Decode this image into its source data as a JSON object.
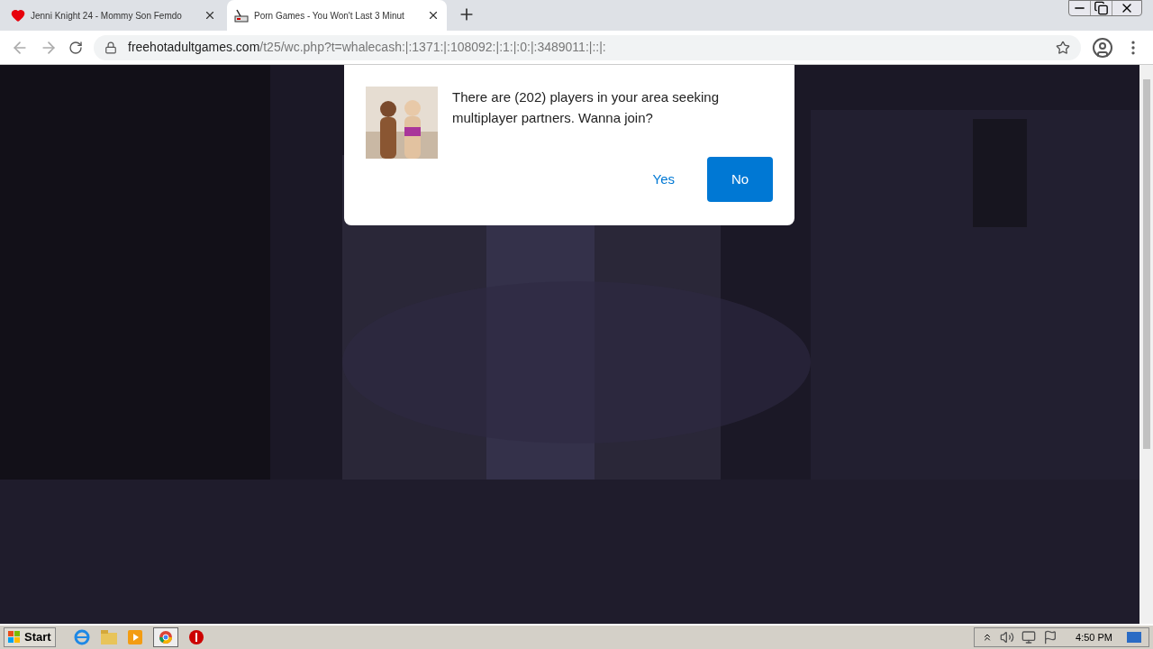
{
  "tabs": [
    {
      "title": "Jenni Knight 24 - Mommy Son Femdo",
      "kind": "heart",
      "selected": false
    },
    {
      "title": "Porn Games - You Won't Last 3 Minut",
      "kind": "joystick",
      "selected": true
    }
  ],
  "address_bar": {
    "domain": "freehotadultgames.com",
    "path": "/t25/wc.php?t=whalecash:|:1371:|:108092:|:1:|:0:|:3489011:|::|:"
  },
  "popup": {
    "message": "There are (202) players in your area seeking multiplayer partners. Wanna join?",
    "buttons": [
      {
        "label": "Yes",
        "kind": "link"
      },
      {
        "label": "No",
        "kind": "primary"
      }
    ]
  },
  "taskbar": {
    "start": "Start",
    "clock": "4:50 PM"
  }
}
